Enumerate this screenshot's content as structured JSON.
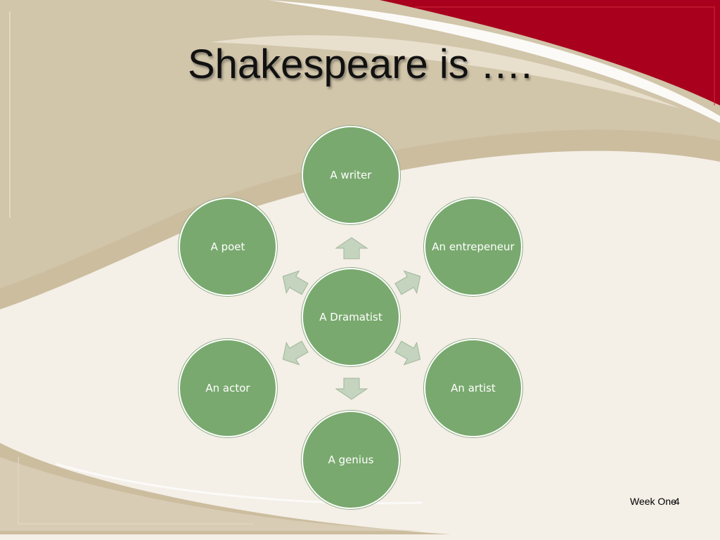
{
  "slide": {
    "title": "Shakespeare is ….",
    "footer_text": "Week One",
    "page_number": "4"
  },
  "diagram": {
    "center": "A Dramatist",
    "nodes": [
      "A writer",
      "An entrepeneur",
      "An artist",
      "A genius",
      "An actor",
      "A poet"
    ]
  },
  "colors": {
    "node_fill": "#79a96e",
    "arrow_fill": "#c4d4be",
    "banner_red": "#a8001d",
    "background_beige": "#cbbd9e"
  }
}
